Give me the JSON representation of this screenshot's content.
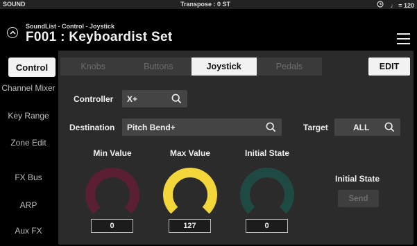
{
  "statusbar": {
    "mode": "SOUND",
    "transpose": "Transpose : 0 ST",
    "tempo": "♩ = 120",
    "clock_icon": "clock-icon"
  },
  "header": {
    "breadcrumb": "SoundList - Control - Joystick",
    "title": "F001 : Keyboardist Set"
  },
  "sidebar": {
    "items": [
      {
        "label": "Control",
        "active": true
      },
      {
        "label": "Channel Mixer"
      },
      {
        "label": "Key Range"
      },
      {
        "label": "Zone Edit"
      },
      {
        "label": "FX Bus"
      },
      {
        "label": "ARP"
      },
      {
        "label": "Aux FX"
      }
    ]
  },
  "tabs": [
    {
      "label": "Knobs"
    },
    {
      "label": "Buttons"
    },
    {
      "label": "Joystick",
      "active": true
    },
    {
      "label": "Pedals"
    }
  ],
  "edit_label": "EDIT",
  "form": {
    "controller_label": "Controller",
    "controller_value": "X+",
    "destination_label": "Destination",
    "destination_value": "Pitch Bend+",
    "target_label": "Target",
    "target_value": "ALL"
  },
  "knobs": [
    {
      "label": "Min Value",
      "value": "0",
      "color": "#5a1f33"
    },
    {
      "label": "Max Value",
      "value": "127",
      "color": "#f2d63a"
    },
    {
      "label": "Initial State",
      "value": "0",
      "color": "#1f4a44"
    }
  ],
  "initial_state": {
    "label": "Initial State",
    "send_label": "Send"
  },
  "colors": {
    "panel": "#2b2b2b",
    "accent_active": "#f2f2f2"
  }
}
